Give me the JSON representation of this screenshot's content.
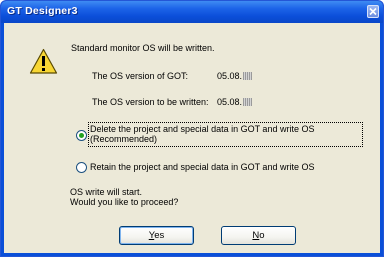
{
  "window": {
    "title": "GT Designer3"
  },
  "message": {
    "heading": "Standard monitor OS will be written.",
    "os_version_got_label": "The OS version of GOT:",
    "os_version_got_value": "05.08.",
    "os_version_write_label": "The OS version to be written:",
    "os_version_write_value": "05.08.",
    "proceed_line1": "OS write will start.",
    "proceed_line2": "Would you like to proceed?"
  },
  "options": [
    {
      "line1": "Delete the project and special data in GOT and write OS",
      "line2": "(Recommended)",
      "selected": true
    },
    {
      "line1": "Retain the project and special data in GOT and write OS",
      "line2": "",
      "selected": false
    }
  ],
  "buttons": {
    "yes_mnemonic": "Y",
    "yes_rest": "es",
    "no_mnemonic": "N",
    "no_rest": "o"
  },
  "icons": {
    "message_icon": "warning-icon",
    "close": "close-icon"
  },
  "colors": {
    "titlebar": "#0b4ed9",
    "client": "#ece9d8",
    "radio_dot": "#21a121"
  }
}
